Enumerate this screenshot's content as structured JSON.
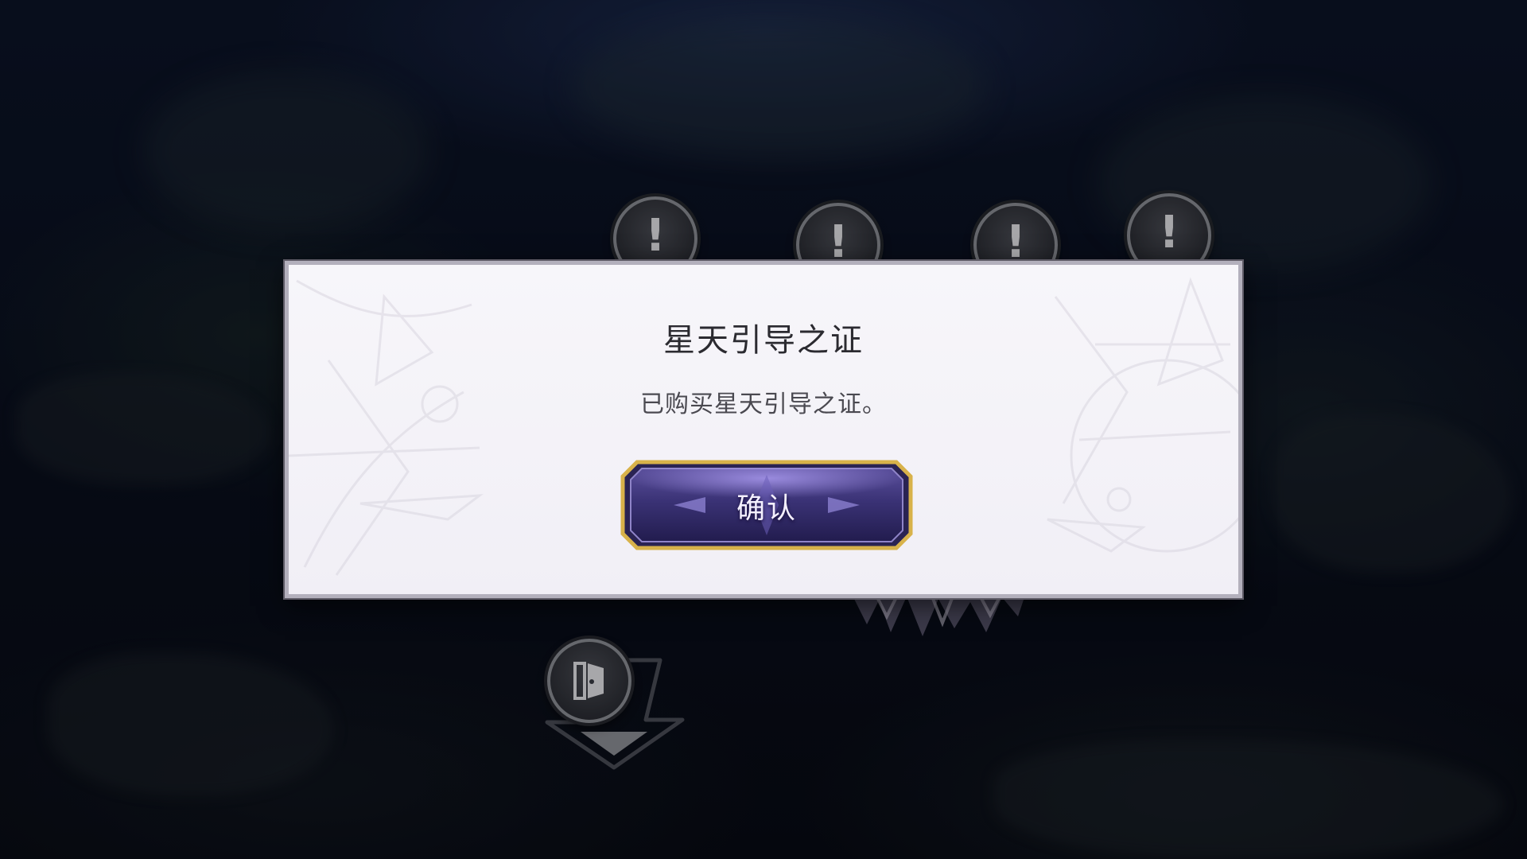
{
  "map": {
    "nodes": [
      {
        "glyph": "!",
        "icon": "exclamation-icon"
      },
      {
        "glyph": "!",
        "icon": "exclamation-icon"
      },
      {
        "glyph": "!",
        "icon": "exclamation-icon"
      },
      {
        "glyph": "!",
        "icon": "exclamation-icon"
      }
    ],
    "exit_icon": "door-exit-icon"
  },
  "dialog": {
    "title": "星天引导之证",
    "message": "已购买星天引导之证。",
    "confirm_label": "确认"
  },
  "colors": {
    "dialog_background": "#f4f2f8",
    "button_fill": "#3c3479",
    "button_border": "#d8b24a"
  }
}
